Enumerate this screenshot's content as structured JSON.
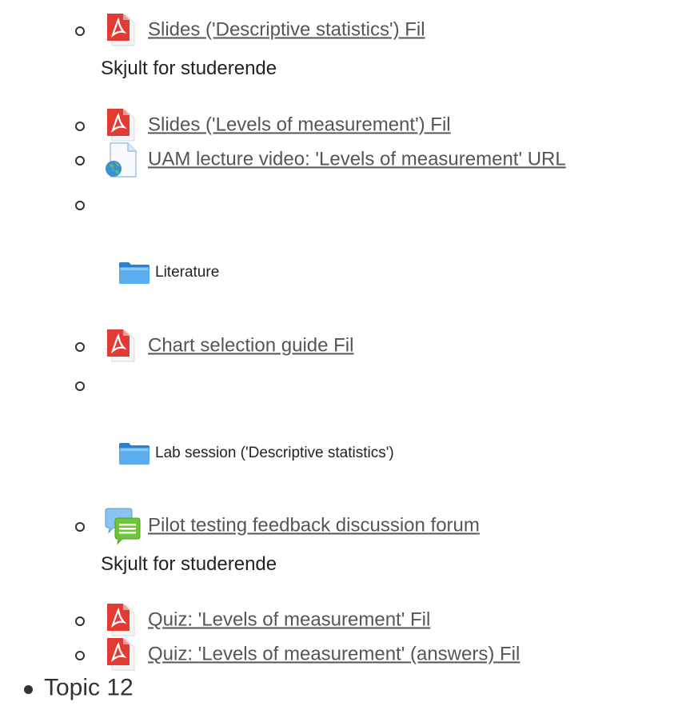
{
  "items": [
    {
      "label": "Slides ('Descriptive statistics') Fil",
      "icon": "pdf-file-icon"
    },
    {
      "note": "Skjult for studerende"
    },
    {
      "label": "Slides ('Levels of measurement') Fil",
      "icon": "pdf-file-icon"
    },
    {
      "label": "UAM lecture video: 'Levels of measurement' URL",
      "icon": "url-globe-icon"
    },
    {
      "folder": "Literature",
      "icon": "folder-icon"
    },
    {
      "label": "Chart selection guide Fil",
      "icon": "pdf-file-icon"
    },
    {
      "folder": "Lab session ('Descriptive statistics')",
      "icon": "folder-icon"
    },
    {
      "label": "Pilot testing feedback discussion forum",
      "icon": "forum-chat-icon"
    },
    {
      "note": "Skjult for studerende"
    },
    {
      "label": "Quiz: 'Levels of measurement' Fil",
      "icon": "pdf-file-icon"
    },
    {
      "label": "Quiz: 'Levels of measurement' (answers) Fil",
      "icon": "pdf-file-icon"
    }
  ],
  "topic": {
    "label": "Topic 12"
  },
  "colors": {
    "pdf_red": "#d61f26",
    "folder_blue": "#4a9fe8",
    "forum_green": "#6cc53a",
    "text": "#333333",
    "link": "#555555"
  }
}
